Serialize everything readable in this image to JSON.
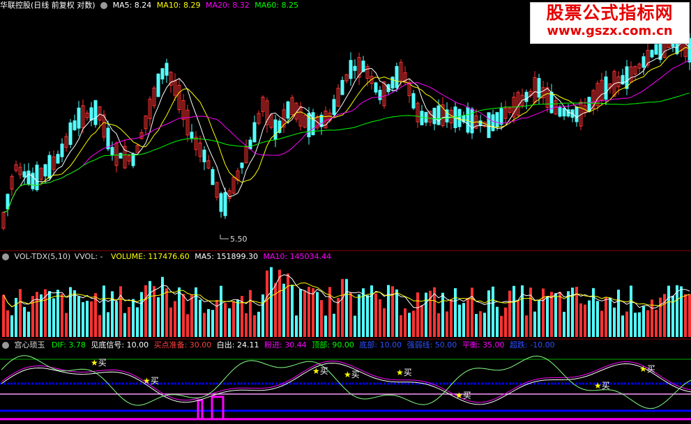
{
  "main_panel": {
    "stock_name": "华联控股(日线 前复权 对数)",
    "ma5": "MA5: 8.24",
    "ma10": "MA10: 8.29",
    "ma20": "MA20: 8.32",
    "ma60": "MA60: 8.25",
    "low_marker": "5.50"
  },
  "watermark": {
    "title": "股票公式指标网",
    "url": "www.gszx.com.cn"
  },
  "volume_panel": {
    "name": "VOL-TDX(5,10)",
    "vvol": "VVOL: -",
    "volume": "VOLUME: 117476.60",
    "ma5": "MA5: 151899.30",
    "ma10": "MA10: 145034.44"
  },
  "indicator_panel": {
    "name": "宫心琐玉",
    "dif": "DIF: 3.78",
    "bottom_signal": "见底信号: 10.00",
    "buy_prepare": "买点准备: 30.00",
    "white_out": "白出: 24.11",
    "pink_in": "粉进: 30.44",
    "top": "顶部: 90.00",
    "bottom": "底部: 10.00",
    "strong_weak": "强弱线: 50.00",
    "balance": "平衡: 35.00",
    "oversold": "超跌: -10.00",
    "buy_label": "买"
  },
  "colors": {
    "up": "#ff3232",
    "down": "#54ffff",
    "ma5": "#ffffff",
    "ma10": "#ffff00",
    "ma20": "#ff00ff",
    "ma60": "#00ff00",
    "panel_border": "#8b0000",
    "pink_line": "#ff00ff",
    "blue_line": "#0000ff"
  }
}
